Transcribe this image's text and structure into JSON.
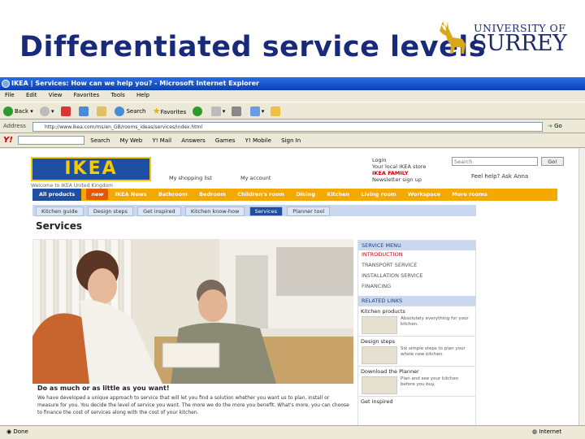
{
  "slide": {
    "title": "Differentiated service levels",
    "logo_university": "UNIVERSITY OF",
    "logo_name": "SURREY"
  },
  "browser": {
    "window_title": "IKEA | Services: How can we help you? - Microsoft Internet Explorer",
    "menu": [
      "File",
      "Edit",
      "View",
      "Favorites",
      "Tools",
      "Help"
    ],
    "toolbar": {
      "back": "Back",
      "search": "Search",
      "favorites": "Favorites"
    },
    "address_label": "Address",
    "address_value": "http://www.ikea.com/ms/en_GB/rooms_ideas/services/index.html",
    "go": "Go",
    "yahoo": {
      "logo": "Y!",
      "items": [
        "Search",
        "My Web",
        "Y! Mail",
        "Answers",
        "Games",
        "Y! Mobile",
        "Sign In"
      ]
    },
    "status_left": "Done",
    "status_right": "Internet"
  },
  "page": {
    "brand": "IKEA",
    "welcome": "Welcome to IKEA United Kingdom",
    "shopping_list": "My shopping list",
    "my_account": "My account",
    "login_links": [
      "Login",
      "Your local IKEA store",
      "IKEA FAMILY",
      "Newsletter sign up"
    ],
    "search_placeholder": "Search",
    "search_go": "Go!",
    "feel_help": "Feel help? Ask Anna",
    "nav": {
      "first": "All products",
      "badge": "new",
      "items": [
        "IKEA News",
        "Bathroom",
        "Bedroom",
        "Children's room",
        "Dining",
        "Kitchen",
        "Living room",
        "Workspace",
        "More rooms"
      ]
    },
    "subtabs": [
      "Kitchen guide",
      "Design steps",
      "Get inspired",
      "Kitchen know-how",
      "Services",
      "Planner tool"
    ],
    "active_subtab": "Services",
    "heading": "Services",
    "caption": "Do as much or as little as you want!",
    "body": "We have developed a unique approach to service that will let you find a solution whether you want us to plan, install or measure for you. You decide the level of service you want. The more we do the more you benefit. What's more, you can choose to finance the cost of services along with the cost of your kitchen.",
    "service_menu": {
      "heading": "SERVICE MENU",
      "items": [
        "INTRODUCTION",
        "TRANSPORT SERVICE",
        "INSTALLATION SERVICE",
        "FINANCING"
      ]
    },
    "related": {
      "heading": "RELATED LINKS",
      "boxes": [
        {
          "title": "Kitchen products",
          "text": "Absolutely everything for your kitchen."
        },
        {
          "title": "Design steps",
          "text": "Six simple steps to plan your whole new kitchen."
        },
        {
          "title": "Download the Planner",
          "text": "Plan and see your kitchen before you buy."
        },
        {
          "title": "Get inspired",
          "text": ""
        }
      ]
    }
  },
  "colors": {
    "slide_title": "#1a2a7a",
    "ikea_blue": "#1e4fa0",
    "ikea_yellow": "#f6c900",
    "nav_orange": "#f5a800",
    "xp_title": "#0a3fb4"
  }
}
